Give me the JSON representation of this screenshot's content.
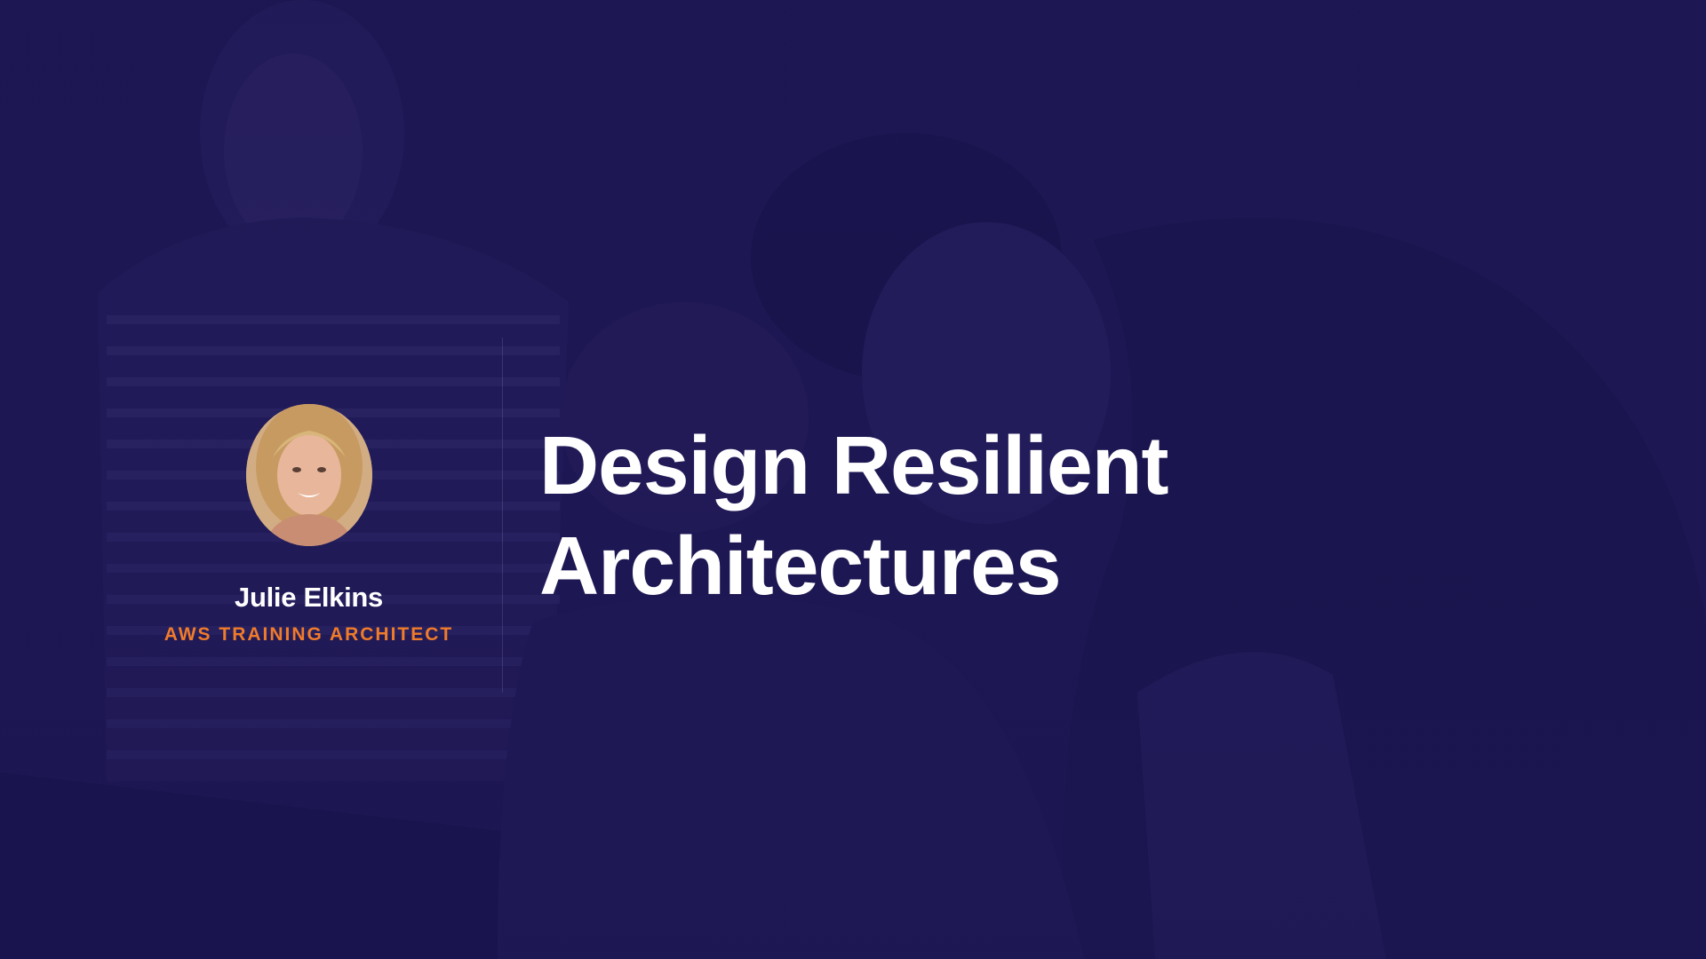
{
  "slide": {
    "title_line1": "Design Resilient",
    "title_line2": "Architectures"
  },
  "presenter": {
    "name": "Julie Elkins",
    "role": "AWS TRAINING ARCHITECT"
  },
  "colors": {
    "background": "#1c1752",
    "title": "#ffffff",
    "role_accent": "#f07b2a"
  }
}
